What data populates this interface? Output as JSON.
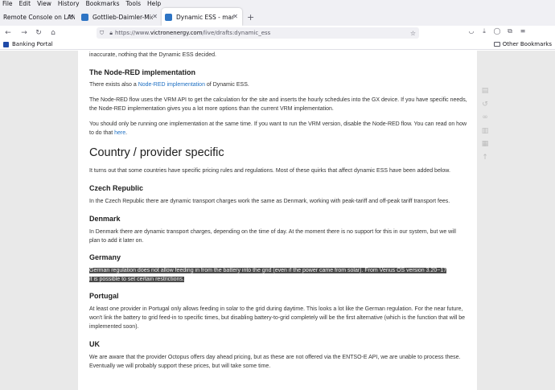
{
  "menu": [
    "File",
    "Edit",
    "View",
    "History",
    "Bookmarks",
    "Tools",
    "Help"
  ],
  "tabs": [
    {
      "title": "Remote Console on LAN",
      "active": false,
      "favicon_color": ""
    },
    {
      "title": "Gottlieb-Daimler-Microgrid",
      "active": false,
      "favicon_color": "#2d74c4"
    },
    {
      "title": "Dynamic ESS - manual [Victr",
      "active": true,
      "favicon_color": "#2d74c4"
    }
  ],
  "url": {
    "scheme": "https://www.",
    "host": "victronenergy.com",
    "path": "/live/drafts:dynamic_ess"
  },
  "bookmarks": {
    "left": "Banking Portal",
    "right": "Other Bookmarks"
  },
  "article": {
    "intro_fragment": "inaccurate, nothing that the Dynamic ESS decided.",
    "nodered_heading": "The Node-RED implementation",
    "nodered_p1_pre": "There exists also a ",
    "nodered_p1_link": "Node-RED implementation",
    "nodered_p1_post": " of Dynamic ESS.",
    "nodered_p2": "The Node-RED flow uses the VRM API to get the calculation for the site and inserts the hourly schedules into the GX device. If you have specific needs, the Node-RED implementation gives you a lot more options than the current VRM implementation.",
    "nodered_p3_pre": "You should only be running one implementation at the same time. If you want to run the VRM version, disable the Node-RED flow. You can read on how to do that ",
    "nodered_p3_link": "here",
    "nodered_p3_post": ".",
    "country_heading": "Country / provider specific",
    "country_p": "It turns out that some countries have specific pricing rules and regulations. Most of these quirks that affect dynamic ESS have been added below.",
    "czech_heading": "Czech Republic",
    "czech_p": "In the Czech Republic there are dynamic transport charges work the same as Denmark, working with peak-tariff and off-peak tariff transport fees.",
    "denmark_heading": "Denmark",
    "denmark_p": "In Denmark there are dynamic transport charges, depending on the time of day. At the moment there is no support for this in our system, but we will plan to add it later on.",
    "germany_heading": "Germany",
    "germany_p1": "German regulation does not allow feeding in from the battery into the grid (even if the power came from solar). From Venus OS version 3.20~17",
    "germany_p2": "it is possible to set certain restrictions.",
    "portugal_heading": "Portugal",
    "portugal_p": "At least one provider in Portugal only allows feeding in solar to the grid during daytime. This looks a lot like the German regulation. For the near future, won't link the battery to grid feed-in to specific times, but disabling battery-to-grid completely will be the first alternative (which is the function that will be implemented soon).",
    "uk_heading": "UK",
    "uk_p": "We are aware that the provider Octopus offers day ahead pricing, but as these are not offered via the ENTSO-E API, we are unable to process these. Eventually we will probably support these prices, but will take some time."
  }
}
